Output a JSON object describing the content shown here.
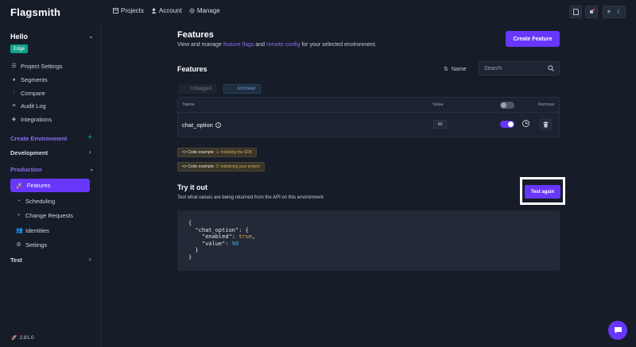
{
  "app": {
    "logo": "Flagsmith"
  },
  "topnav": [
    {
      "label": "Projects",
      "icon": "projects-icon"
    },
    {
      "label": "Account",
      "icon": "user-icon"
    },
    {
      "label": "Manage",
      "icon": "gear-icon"
    }
  ],
  "sidebar": {
    "project": "Hello",
    "environment_badge": "Edge",
    "links": [
      {
        "label": "Project Settings",
        "icon": "sliders-icon"
      },
      {
        "label": "Segments",
        "icon": "pie-icon"
      },
      {
        "label": "Compare",
        "icon": "bars-icon"
      },
      {
        "label": "Audit Log",
        "icon": "list-icon"
      },
      {
        "label": "Integrations",
        "icon": "layers-icon"
      }
    ],
    "create_env": "Create Environment",
    "environments": {
      "development": "Development",
      "production": "Production",
      "test": "Test"
    },
    "production_items": [
      {
        "label": "Features",
        "icon": "rocket-icon",
        "active": true
      },
      {
        "label": "Scheduling",
        "icon": "clock-icon"
      },
      {
        "label": "Change Requests",
        "icon": "branch-icon"
      },
      {
        "label": "Identities",
        "icon": "users-icon"
      },
      {
        "label": "Settings",
        "icon": "gear-icon"
      }
    ],
    "version": "2.81.0"
  },
  "main": {
    "title": "Features",
    "subtitle_pre": "View and manage ",
    "subtitle_link1": "feature flags",
    "subtitle_mid": " and ",
    "subtitle_link2": "remote config",
    "subtitle_post": " for your selected environment.",
    "create_button": "Create Feature",
    "section_title": "Features",
    "sort_label": "Name",
    "search_placeholder": "Search",
    "tags": {
      "untagged": "Untagged",
      "archived": "Archived"
    },
    "table": {
      "headers": {
        "name": "Name",
        "value": "Value",
        "remove": "Remove"
      },
      "rows": [
        {
          "name": "chat_option",
          "value": "90",
          "enabled": true
        }
      ]
    },
    "code_examples": [
      {
        "prefix": "<> Code example: ",
        "highlight": "1: Installing the SDK"
      },
      {
        "prefix": "<> Code example: ",
        "highlight": "2: Initialising your project"
      }
    ],
    "try_title": "Try it out",
    "try_subtitle": "Test what values are being returned from the API on this environment",
    "test_button": "Test again",
    "code": {
      "line1": "{",
      "line2": "  \"chat_option\": {",
      "line3_key": "    \"enabled\": ",
      "line3_val": "true",
      "line3_end": ",",
      "line4_key": "    \"value\": ",
      "line4_val": "90",
      "line5": "  }",
      "line6": "}"
    }
  }
}
